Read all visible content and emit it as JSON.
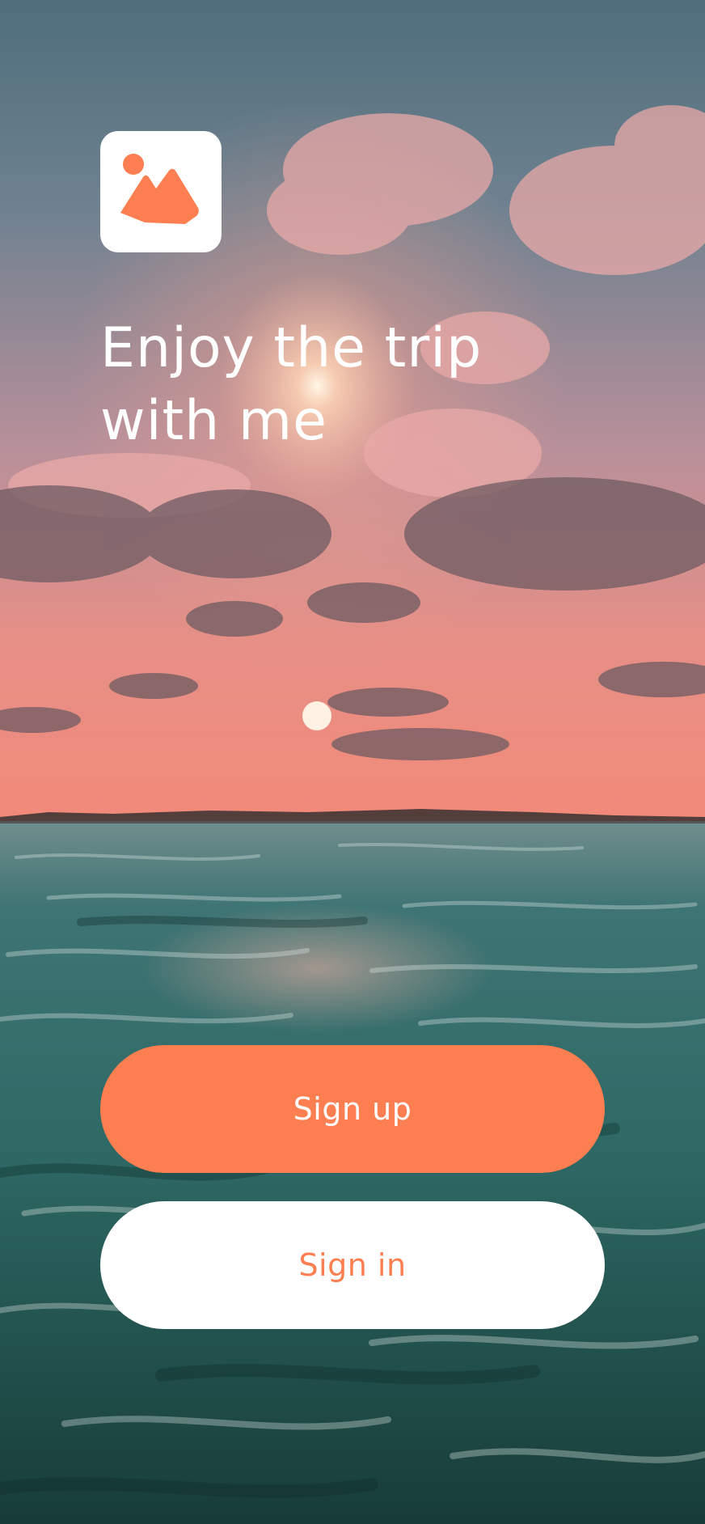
{
  "headline": {
    "line1": "Enjoy the trip",
    "line2": "with me"
  },
  "logo": {
    "icon": "image-placeholder-icon"
  },
  "actions": {
    "signup_label": "Sign up",
    "signin_label": "Sign in"
  },
  "colors": {
    "accent": "#fd7e50",
    "surface": "#ffffff",
    "text_on_accent": "#ffffff"
  }
}
